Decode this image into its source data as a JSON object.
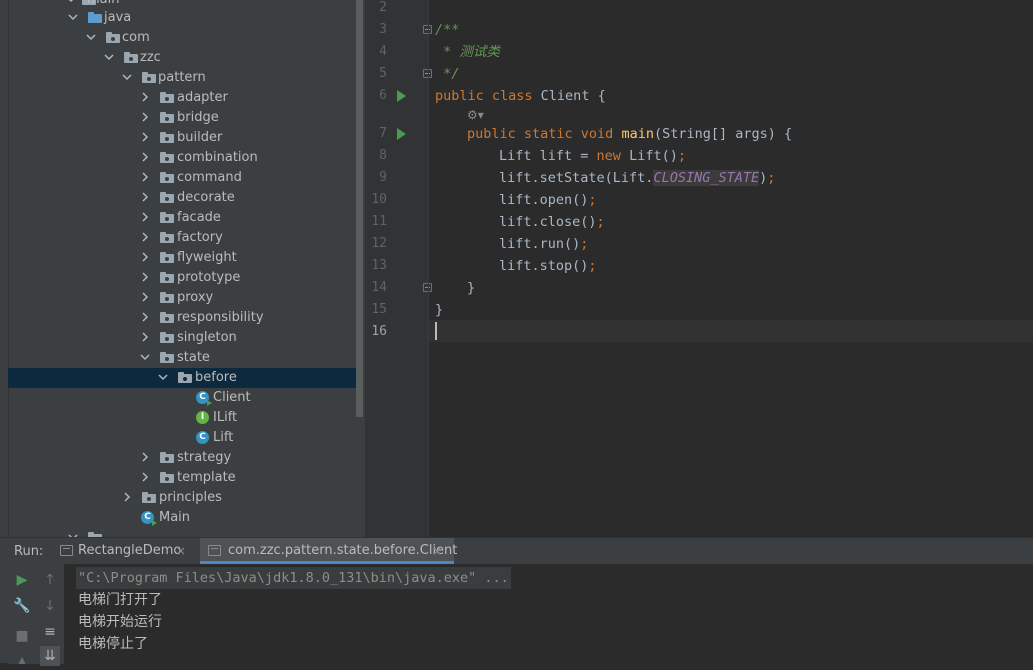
{
  "project_tree": {
    "items": [
      {
        "label": "main",
        "type": "folder"
      },
      {
        "label": "java",
        "type": "folder-blue"
      },
      {
        "label": "com",
        "type": "package"
      },
      {
        "label": "zzc",
        "type": "package"
      },
      {
        "label": "pattern",
        "type": "package"
      },
      {
        "label": "adapter",
        "type": "package"
      },
      {
        "label": "bridge",
        "type": "package"
      },
      {
        "label": "builder",
        "type": "package"
      },
      {
        "label": "combination",
        "type": "package"
      },
      {
        "label": "command",
        "type": "package"
      },
      {
        "label": "decorate",
        "type": "package"
      },
      {
        "label": "facade",
        "type": "package"
      },
      {
        "label": "factory",
        "type": "package"
      },
      {
        "label": "flyweight",
        "type": "package"
      },
      {
        "label": "prototype",
        "type": "package"
      },
      {
        "label": "proxy",
        "type": "package"
      },
      {
        "label": "responsibility",
        "type": "package"
      },
      {
        "label": "singleton",
        "type": "package"
      },
      {
        "label": "state",
        "type": "package"
      },
      {
        "label": "before",
        "type": "package",
        "selected": true
      },
      {
        "label": "Client",
        "type": "class"
      },
      {
        "label": "ILift",
        "type": "interface"
      },
      {
        "label": "Lift",
        "type": "class"
      },
      {
        "label": "strategy",
        "type": "package"
      },
      {
        "label": "template",
        "type": "package"
      },
      {
        "label": "principles",
        "type": "package"
      },
      {
        "label": "Main",
        "type": "class-main"
      }
    ]
  },
  "editor": {
    "line_numbers": [
      "2",
      "3",
      "4",
      "5",
      "6",
      "7",
      "8",
      "9",
      "10",
      "11",
      "12",
      "13",
      "14",
      "15",
      "16"
    ],
    "current_line": "16",
    "code": {
      "l3": "/**",
      "l4": " * 测试类",
      "l5": " */",
      "l6_kw": "public class",
      "l6_rest": " Client {",
      "l7_kw": "public static void",
      "l7_fn": "main",
      "l7_rest": "(String[] args) {",
      "l8_a": "Lift lift = ",
      "l8_kw": "new",
      "l8_b": " Lift()",
      "l8_semi": ";",
      "l9_a": "lift.setState(Lift.",
      "l9_const": "CLOSING_STATE",
      "l9_b": ")",
      "l9_semi": ";",
      "l10_a": "lift.open()",
      "l11_a": "lift.close()",
      "l12_a": "lift.run()",
      "l13_a": "lift.stop()",
      "semi": ";",
      "l14": "}",
      "l15": "}"
    }
  },
  "run_panel": {
    "label": "Run:",
    "tabs": [
      {
        "label": "RectangleDemo",
        "close": "×"
      },
      {
        "label": "com.zzc.pattern.state.before.Client",
        "close": "×"
      }
    ],
    "output": [
      "\"C:\\Program Files\\Java\\jdk1.8.0_131\\bin\\java.exe\" ...",
      "电梯门打开了",
      "电梯开始运行",
      "电梯停止了"
    ]
  },
  "colors": {
    "keyword": "#cc7832",
    "comment": "#629755",
    "method": "#ffc66d",
    "constant": "#9876aa",
    "selection": "#0d293e"
  }
}
